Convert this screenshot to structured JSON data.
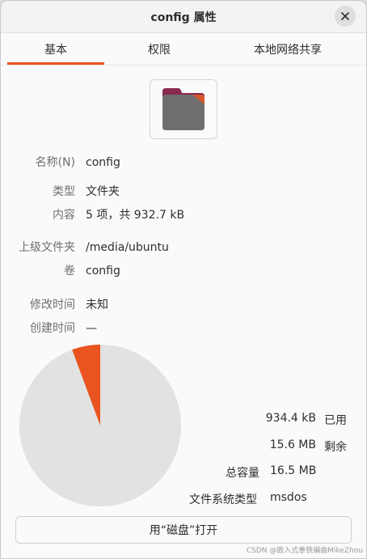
{
  "window": {
    "title": "config 属性",
    "close_icon": "close-icon"
  },
  "tabs": [
    {
      "label": "基本",
      "active": true
    },
    {
      "label": "权限",
      "active": false
    },
    {
      "label": "本地网络共享",
      "active": false
    }
  ],
  "folder_icon": "folder-icon",
  "properties": {
    "name": {
      "label": "名称(N)",
      "value": "config"
    },
    "type": {
      "label": "类型",
      "value": "文件夹"
    },
    "contents": {
      "label": "内容",
      "value": "5 项，共 932.7 kB"
    },
    "parent": {
      "label": "上级文件夹",
      "value": "/media/ubuntu"
    },
    "volume": {
      "label": "卷",
      "value": "config"
    },
    "modified": {
      "label": "修改时间",
      "value": "未知"
    },
    "created": {
      "label": "创建时间",
      "value": "—"
    }
  },
  "usage": {
    "used": {
      "value": "934.4 kB",
      "label": "已用"
    },
    "free": {
      "value": "15.6 MB",
      "label": "剩余"
    },
    "total": {
      "label": "总容量",
      "value": "16.5 MB"
    },
    "fs_type": {
      "label": "文件系统类型",
      "value": "msdos"
    },
    "used_fraction": 0.0566,
    "used_color": "#e95420",
    "free_color": "#e2e2e2"
  },
  "open_button": {
    "label": "用“磁盘”打开"
  },
  "watermark": "CSDN @嵌入式拳铁编曲MikeZhou",
  "colors": {
    "accent": "#e95420"
  }
}
